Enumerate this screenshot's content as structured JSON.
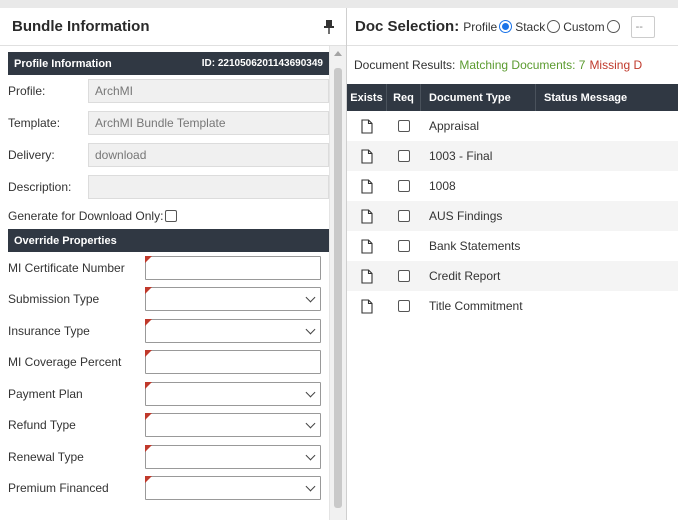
{
  "bundle": {
    "title": "Bundle Information",
    "pin_icon": "pin-icon",
    "profile_section": {
      "title": "Profile Information",
      "id_text": "ID: 2210506201143690349"
    },
    "fields": [
      {
        "label": "Profile:",
        "value": "ArchMI"
      },
      {
        "label": "Template:",
        "value": "ArchMI Bundle Template"
      },
      {
        "label": "Delivery:",
        "value": "download"
      },
      {
        "label": "Description:",
        "value": ""
      }
    ],
    "download_only_label": "Generate for Download Only:",
    "download_only_checked": false,
    "override_section": {
      "title": "Override Properties"
    },
    "overrides": [
      {
        "label": "MI Certificate Number",
        "type": "text"
      },
      {
        "label": "Submission Type",
        "type": "select"
      },
      {
        "label": "Insurance Type",
        "type": "select"
      },
      {
        "label": "MI Coverage Percent",
        "type": "text"
      },
      {
        "label": "Payment Plan",
        "type": "select"
      },
      {
        "label": "Refund Type",
        "type": "select"
      },
      {
        "label": "Renewal Type",
        "type": "select"
      },
      {
        "label": "Premium Financed",
        "type": "select"
      }
    ]
  },
  "docsel": {
    "title": "Doc Selection:",
    "options": [
      {
        "label": "Profile",
        "selected": true
      },
      {
        "label": "Stack",
        "selected": false
      },
      {
        "label": "Custom",
        "selected": false
      }
    ],
    "more_label": "--",
    "results_label": "Document Results:",
    "matching_label": "Matching Documents: 7",
    "missing_label": "Missing D",
    "columns": [
      "Exists",
      "Req",
      "Document Type",
      "Status Message"
    ],
    "rows": [
      {
        "doc": "Appraisal",
        "status": ""
      },
      {
        "doc": "1003 - Final",
        "status": ""
      },
      {
        "doc": "1008",
        "status": ""
      },
      {
        "doc": "AUS Findings",
        "status": ""
      },
      {
        "doc": "Bank Statements",
        "status": ""
      },
      {
        "doc": "Credit Report",
        "status": ""
      },
      {
        "doc": "Title Commitment",
        "status": ""
      }
    ]
  },
  "colors": {
    "header_bar": "#303843",
    "matching": "#5b9b2f",
    "missing": "#c0392b",
    "radio_selected": "#1a73e8",
    "required_marker": "#c0392b"
  }
}
